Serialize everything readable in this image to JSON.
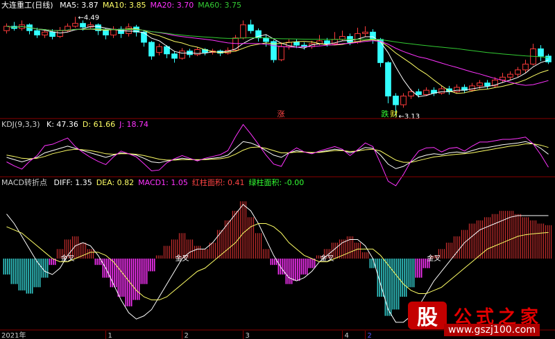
{
  "main_panel": {
    "stock_name": "大连重工(日线)",
    "indicators": [
      {
        "label": "MA5: 3.87",
        "color": "#ffffff"
      },
      {
        "label": "MA10: 3.85",
        "color": "#ffff66"
      },
      {
        "label": "MA20: 3.70",
        "color": "#ff33ff"
      },
      {
        "label": "MA60: 3.75",
        "color": "#33cc33"
      }
    ],
    "high_label": "4.49",
    "low_label": "3.13",
    "signals": [
      "涨",
      "跌",
      "财"
    ]
  },
  "kdj_panel": {
    "name": "KDJ(9,3,3)",
    "values": [
      {
        "label": "K: 47.36",
        "color": "#ffffff"
      },
      {
        "label": "D: 61.66",
        "color": "#ffff66"
      },
      {
        "label": "J: 18.74",
        "color": "#ff33ff"
      }
    ]
  },
  "macd_panel": {
    "name": "MACD转折点",
    "values": [
      {
        "label": "DIFF: 1.35",
        "color": "#ffffff"
      },
      {
        "label": "DEA: 0.82",
        "color": "#ffff66"
      },
      {
        "label": "MACD1: 1.05",
        "color": "#ff33ff"
      },
      {
        "label": "红柱面积: 0.41",
        "color": "#ff4444"
      },
      {
        "label": "绿柱面积: -0.00",
        "color": "#33ff33"
      }
    ],
    "cross_label": "金叉"
  },
  "x_axis": {
    "labels": [
      {
        "text": "2021年",
        "i": 0
      },
      {
        "text": "1",
        "i": 13
      },
      {
        "text": "2",
        "i": 23
      },
      {
        "text": "3",
        "i": 31
      },
      {
        "text": "4",
        "i": 44
      },
      {
        "text": "2",
        "i": 47
      }
    ]
  },
  "watermark": {
    "badge": "股",
    "title": "公式之家",
    "url": "www.gszj100.com"
  },
  "chart_data": {
    "type": "candlestick",
    "price_ylim": [
      3.1,
      4.55
    ],
    "candles": [
      [
        4.3,
        4.36,
        4.4,
        4.26
      ],
      [
        4.36,
        4.33,
        4.42,
        4.3
      ],
      [
        4.33,
        4.38,
        4.44,
        4.3
      ],
      [
        4.38,
        4.3,
        4.4,
        4.25
      ],
      [
        4.3,
        4.24,
        4.34,
        4.2
      ],
      [
        4.24,
        4.28,
        4.31,
        4.2
      ],
      [
        4.28,
        4.22,
        4.32,
        4.18
      ],
      [
        4.22,
        4.3,
        4.35,
        4.2
      ],
      [
        4.3,
        4.36,
        4.4,
        4.28
      ],
      [
        4.36,
        4.4,
        4.49,
        4.34
      ],
      [
        4.4,
        4.35,
        4.44,
        4.3
      ],
      [
        4.35,
        4.38,
        4.42,
        4.32
      ],
      [
        4.38,
        4.3,
        4.4,
        4.24
      ],
      [
        4.3,
        4.24,
        4.33,
        4.18
      ],
      [
        4.24,
        4.32,
        4.36,
        4.2
      ],
      [
        4.32,
        4.26,
        4.36,
        4.2
      ],
      [
        4.26,
        4.35,
        4.4,
        4.22
      ],
      [
        4.35,
        4.28,
        4.38,
        4.22
      ],
      [
        4.28,
        4.14,
        4.3,
        4.08
      ],
      [
        4.14,
        3.95,
        4.16,
        3.9
      ],
      [
        4.0,
        4.08,
        4.12,
        3.96
      ],
      [
        4.08,
        3.98,
        4.1,
        3.92
      ],
      [
        3.98,
        3.92,
        4.02,
        3.86
      ],
      [
        3.92,
        4.02,
        4.06,
        3.9
      ],
      [
        4.02,
        3.97,
        4.05,
        3.93
      ],
      [
        3.97,
        4.04,
        4.07,
        3.95
      ],
      [
        4.04,
        4.0,
        4.06,
        3.96
      ],
      [
        4.0,
        4.02,
        4.05,
        3.97
      ],
      [
        4.02,
        3.99,
        4.04,
        3.95
      ],
      [
        3.99,
        4.03,
        4.07,
        3.97
      ],
      [
        4.03,
        4.2,
        4.24,
        4.02
      ],
      [
        4.2,
        4.38,
        4.44,
        4.18
      ],
      [
        4.38,
        4.3,
        4.45,
        4.26
      ],
      [
        4.3,
        4.2,
        4.33,
        4.15
      ],
      [
        4.2,
        4.15,
        4.24,
        4.08
      ],
      [
        4.15,
        3.9,
        4.17,
        3.86
      ],
      [
        3.9,
        4.08,
        4.14,
        3.88
      ],
      [
        4.08,
        4.14,
        4.18,
        4.04
      ],
      [
        4.14,
        4.1,
        4.18,
        4.06
      ],
      [
        4.1,
        4.08,
        4.14,
        4.04
      ],
      [
        4.08,
        4.12,
        4.16,
        4.05
      ],
      [
        4.12,
        4.16,
        4.24,
        4.1
      ],
      [
        4.16,
        4.12,
        4.2,
        4.08
      ],
      [
        4.12,
        4.18,
        4.28,
        4.1
      ],
      [
        4.18,
        4.22,
        4.3,
        4.16
      ],
      [
        4.22,
        4.14,
        4.26,
        4.1
      ],
      [
        4.14,
        4.26,
        4.34,
        4.12
      ],
      [
        4.26,
        4.28,
        4.36,
        4.22
      ],
      [
        4.28,
        4.18,
        4.32,
        4.12
      ],
      [
        4.18,
        3.86,
        4.2,
        3.8
      ],
      [
        3.86,
        3.4,
        3.88,
        3.3
      ],
      [
        3.4,
        3.28,
        3.44,
        3.13
      ],
      [
        3.28,
        3.4,
        3.44,
        3.24
      ],
      [
        3.4,
        3.46,
        3.5,
        3.36
      ],
      [
        3.46,
        3.42,
        3.5,
        3.38
      ],
      [
        3.42,
        3.48,
        3.52,
        3.4
      ],
      [
        3.48,
        3.44,
        3.52,
        3.4
      ],
      [
        3.44,
        3.5,
        3.54,
        3.42
      ],
      [
        3.5,
        3.46,
        3.54,
        3.42
      ],
      [
        3.46,
        3.52,
        3.56,
        3.44
      ],
      [
        3.52,
        3.48,
        3.56,
        3.44
      ],
      [
        3.48,
        3.54,
        3.58,
        3.46
      ],
      [
        3.54,
        3.58,
        3.62,
        3.5
      ],
      [
        3.58,
        3.54,
        3.62,
        3.5
      ],
      [
        3.54,
        3.62,
        3.66,
        3.52
      ],
      [
        3.62,
        3.66,
        3.72,
        3.58
      ],
      [
        3.66,
        3.7,
        3.74,
        3.62
      ],
      [
        3.7,
        3.76,
        3.8,
        3.66
      ],
      [
        3.76,
        3.84,
        3.9,
        3.72
      ],
      [
        3.84,
        4.05,
        4.12,
        3.82
      ],
      [
        4.05,
        3.95,
        4.1,
        3.88
      ],
      [
        3.95,
        3.87,
        3.98,
        3.84
      ]
    ],
    "kdj_ylim": [
      0,
      100
    ],
    "kdj": {
      "K": [
        40,
        35,
        30,
        35,
        40,
        50,
        55,
        60,
        65,
        60,
        55,
        50,
        45,
        40,
        45,
        50,
        48,
        45,
        38,
        30,
        28,
        32,
        35,
        38,
        36,
        34,
        36,
        38,
        40,
        45,
        60,
        75,
        72,
        65,
        55,
        45,
        40,
        50,
        55,
        52,
        50,
        52,
        55,
        58,
        56,
        50,
        55,
        62,
        60,
        45,
        25,
        15,
        20,
        30,
        40,
        45,
        48,
        46,
        50,
        52,
        50,
        55,
        60,
        62,
        65,
        68,
        70,
        72,
        75,
        70,
        60,
        47
      ],
      "D": [
        45,
        42,
        38,
        37,
        38,
        42,
        48,
        52,
        56,
        58,
        57,
        55,
        52,
        48,
        47,
        48,
        48,
        47,
        44,
        40,
        36,
        34,
        34,
        35,
        35,
        35,
        35,
        36,
        37,
        40,
        47,
        56,
        62,
        63,
        60,
        55,
        50,
        50,
        52,
        52,
        51,
        51,
        53,
        55,
        55,
        53,
        54,
        57,
        58,
        54,
        44,
        34,
        29,
        29,
        33,
        37,
        41,
        43,
        45,
        47,
        48,
        50,
        53,
        56,
        59,
        62,
        65,
        67,
        70,
        70,
        67,
        62
      ],
      "J": [
        30,
        21,
        14,
        31,
        44,
        66,
        69,
        76,
        83,
        64,
        51,
        40,
        31,
        24,
        41,
        54,
        48,
        41,
        26,
        10,
        12,
        28,
        37,
        44,
        38,
        32,
        38,
        42,
        46,
        55,
        86,
        113,
        92,
        69,
        45,
        25,
        20,
        50,
        61,
        52,
        48,
        54,
        59,
        64,
        58,
        44,
        57,
        72,
        64,
        27,
        -13,
        -23,
        2,
        32,
        54,
        61,
        62,
        52,
        60,
        62,
        54,
        65,
        74,
        74,
        77,
        80,
        80,
        82,
        85,
        70,
        46,
        18
      ]
    },
    "macd_ylim": [
      -2.2,
      2.2
    ],
    "macd": {
      "bars": [
        -0.5,
        -0.8,
        -1.0,
        -1.1,
        -0.9,
        -0.6,
        -0.2,
        0.3,
        0.6,
        0.7,
        0.5,
        0.3,
        -0.2,
        -0.6,
        -0.9,
        -1.2,
        -1.5,
        -1.3,
        -0.8,
        -0.4,
        0.1,
        0.4,
        0.6,
        0.8,
        0.6,
        0.4,
        0.3,
        0.5,
        0.9,
        1.2,
        1.5,
        1.8,
        1.3,
        0.8,
        0.3,
        -0.2,
        -0.5,
        -0.8,
        -0.7,
        -0.5,
        -0.3,
        0.1,
        0.3,
        0.5,
        0.6,
        0.7,
        0.5,
        0.2,
        -0.3,
        -1.2,
        -1.8,
        -1.6,
        -1.2,
        -0.9,
        -0.6,
        -0.3,
        0.1,
        0.3,
        0.5,
        0.7,
        0.9,
        1.1,
        1.2,
        1.3,
        1.4,
        1.5,
        1.5,
        1.4,
        1.3,
        1.2,
        1.1,
        1.05
      ],
      "DIFF": [
        1.4,
        1.1,
        0.7,
        0.3,
        -0.1,
        -0.4,
        -0.5,
        -0.3,
        0.1,
        0.4,
        0.5,
        0.4,
        0.1,
        -0.3,
        -0.8,
        -1.3,
        -1.7,
        -1.9,
        -1.8,
        -1.6,
        -1.2,
        -0.8,
        -0.4,
        0.0,
        0.2,
        0.3,
        0.3,
        0.5,
        0.8,
        1.1,
        1.4,
        1.7,
        1.5,
        1.1,
        0.6,
        0.1,
        -0.3,
        -0.6,
        -0.7,
        -0.6,
        -0.4,
        -0.1,
        0.1,
        0.3,
        0.5,
        0.6,
        0.6,
        0.4,
        0.0,
        -0.8,
        -1.6,
        -2.0,
        -2.0,
        -1.8,
        -1.5,
        -1.1,
        -0.7,
        -0.4,
        -0.1,
        0.2,
        0.5,
        0.7,
        0.9,
        1.0,
        1.1,
        1.2,
        1.3,
        1.35,
        1.35,
        1.35,
        1.35,
        1.35
      ],
      "DEA": [
        1.0,
        0.9,
        0.8,
        0.6,
        0.4,
        0.2,
        0.0,
        -0.1,
        -0.1,
        0.0,
        0.1,
        0.2,
        0.2,
        0.1,
        -0.1,
        -0.4,
        -0.7,
        -1.0,
        -1.2,
        -1.3,
        -1.3,
        -1.2,
        -1.0,
        -0.8,
        -0.6,
        -0.4,
        -0.3,
        -0.1,
        0.1,
        0.3,
        0.5,
        0.8,
        1.0,
        1.1,
        1.1,
        1.0,
        0.8,
        0.5,
        0.3,
        0.1,
        0.0,
        -0.1,
        -0.1,
        0.0,
        0.1,
        0.2,
        0.3,
        0.3,
        0.3,
        0.1,
        -0.2,
        -0.5,
        -0.8,
        -1.0,
        -1.1,
        -1.1,
        -1.0,
        -0.9,
        -0.7,
        -0.5,
        -0.3,
        -0.1,
        0.1,
        0.3,
        0.4,
        0.5,
        0.6,
        0.7,
        0.75,
        0.78,
        0.8,
        0.82
      ]
    },
    "golden_cross_at": [
      8,
      23,
      42,
      56
    ]
  }
}
